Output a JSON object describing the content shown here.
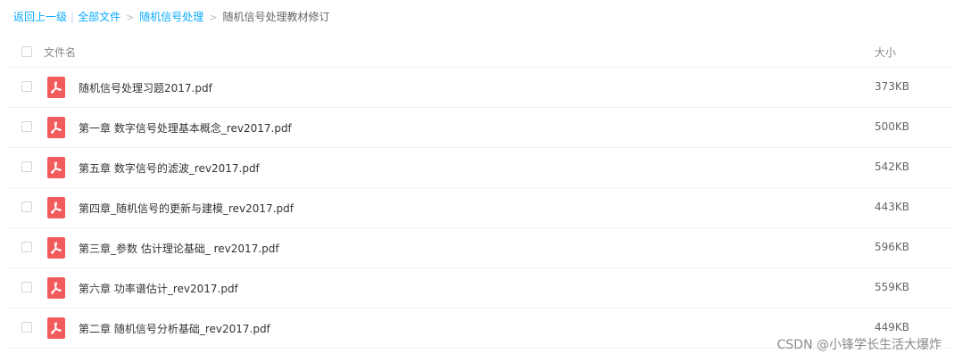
{
  "breadcrumb": {
    "back": "返回上一级",
    "separator": "|",
    "all_files": "全部文件",
    "arrow": ">",
    "folder": "随机信号处理",
    "current": "随机信号处理教材修订"
  },
  "table": {
    "col_name": "文件名",
    "col_size": "大小"
  },
  "files": [
    {
      "name": "随机信号处理习题2017.pdf",
      "size": "373KB",
      "icon": "pdf-icon"
    },
    {
      "name": "第一章 数字信号处理基本概念_rev2017.pdf",
      "size": "500KB",
      "icon": "pdf-icon"
    },
    {
      "name": "第五章 数字信号的滤波_rev2017.pdf",
      "size": "542KB",
      "icon": "pdf-icon"
    },
    {
      "name": "第四章_随机信号的更新与建模_rev2017.pdf",
      "size": "443KB",
      "icon": "pdf-icon"
    },
    {
      "name": "第三章_参数 估计理论基础_ rev2017.pdf",
      "size": "596KB",
      "icon": "pdf-icon"
    },
    {
      "name": "第六章 功率谱估计_rev2017.pdf",
      "size": "559KB",
      "icon": "pdf-icon"
    },
    {
      "name": "第二章 随机信号分析基础_rev2017.pdf",
      "size": "449KB",
      "icon": "pdf-icon"
    }
  ],
  "watermark": "CSDN @小锋学长生活大爆炸",
  "colors": {
    "link": "#09AAFF",
    "pdf_icon": "#f25b5b",
    "text": "#333333",
    "muted": "#888888"
  }
}
